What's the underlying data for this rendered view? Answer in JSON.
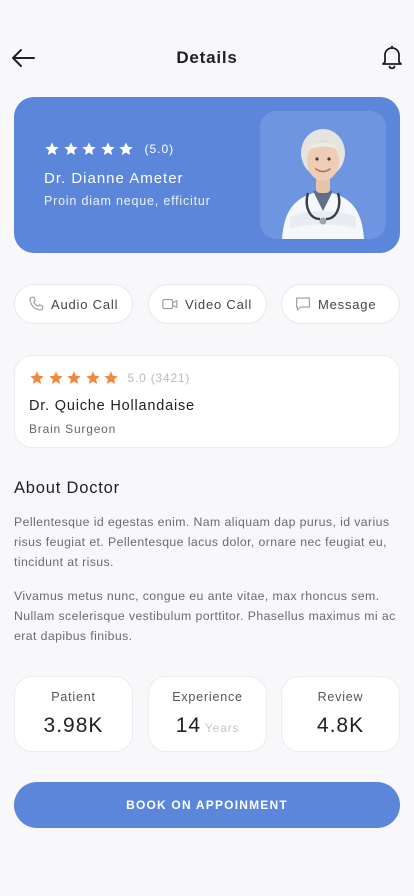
{
  "header": {
    "title": "Details",
    "back_icon": "arrow-left-icon",
    "bell_icon": "bell-icon"
  },
  "hero": {
    "stars": 5,
    "rating": "(5.0)",
    "name": "Dr. Dianne Ameter",
    "subtitle": "Proin diam neque, efficitur",
    "star_color": "#ffffff",
    "background": "#5b86da"
  },
  "actions": [
    {
      "label": "Audio Call",
      "icon": "phone-icon"
    },
    {
      "label": "Video Call",
      "icon": "video-camera-icon"
    },
    {
      "label": "Message",
      "icon": "chat-bubble-icon"
    }
  ],
  "doctor": {
    "stars": 5,
    "rating": "5.0 (3421)",
    "name": "Dr. Quiche Hollandaise",
    "specialty": "Brain Surgeon",
    "star_color": "#f0883e"
  },
  "about": {
    "title": "About Doctor",
    "paragraph1": "Pellentesque id egestas enim. Nam aliquam dap purus, id varius risus feugiat et. Pellentesque lacus dolor, ornare nec feugiat eu, tincidunt at risus.",
    "paragraph2": "Vivamus metus nunc, congue eu ante vitae, max rhoncus sem. Nullam scelerisque vestibulum porttitor. Phasellus maximus mi ac erat dapibus finibus."
  },
  "stats": [
    {
      "label": "Patient",
      "value": "3.98K",
      "unit": ""
    },
    {
      "label": "Experience",
      "value": "14",
      "unit": "Years"
    },
    {
      "label": "Review",
      "value": "4.8K",
      "unit": ""
    }
  ],
  "book_button": "BOOK ON APPOINMENT"
}
